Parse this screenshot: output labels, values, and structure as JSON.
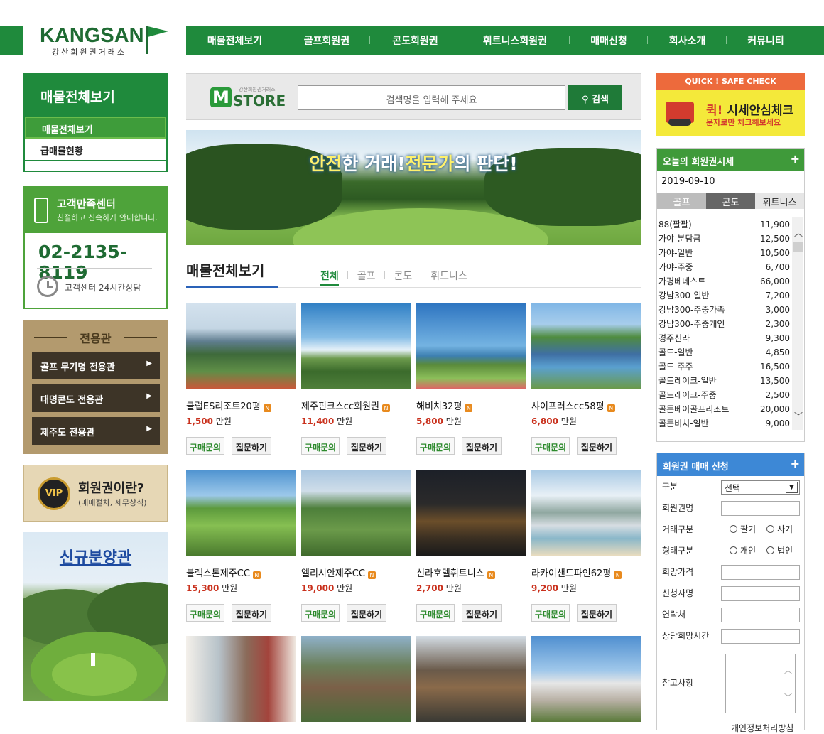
{
  "header": {
    "logo": {
      "brand": "KANGSAN",
      "sub": "강산회원권거래소"
    },
    "nav": [
      "매물전체보기",
      "골프회원권",
      "콘도회원권",
      "휘트니스회원권",
      "매매신청",
      "회사소개",
      "커뮤니티"
    ]
  },
  "sidebar": {
    "category_title": "매물전체보기",
    "items": [
      "매물전체보기",
      "급매물현황"
    ],
    "cs": {
      "title": "고객만족센터",
      "desc": "친절하고 신속하게 안내합니다.",
      "phone": "02-2135-8119",
      "hours": "고객센터 24시간상담"
    },
    "pavilion": {
      "title": "전용관",
      "buttons": [
        "골프 무기명 전용관",
        "대명콘도 전용관",
        "제주도 전용관"
      ]
    },
    "vip": {
      "badge": "VIP",
      "title": "회원권이란?",
      "desc": "(매매절차, 세무상식)"
    },
    "new_sale": "신규분양관"
  },
  "search": {
    "logo": "STORE",
    "logo_small": "강산회원권거래소",
    "placeholder": "검색명을 입력해 주세요",
    "button": "검색"
  },
  "banner": {
    "text_pre": "한 거래!",
    "text_hl1": "안전",
    "text_hl2": "전문가",
    "text_post": "의 판단!"
  },
  "listing": {
    "title": "매물전체보기",
    "tabs": [
      "전체",
      "골프",
      "콘도",
      "휘트니스"
    ],
    "unit": "만원",
    "btn_buy": "구매문의",
    "btn_ask": "질문하기",
    "products": [
      {
        "name": "클럽ES리조트20평",
        "price": "1,500"
      },
      {
        "name": "제주핀크스cc회원권",
        "price": "11,400"
      },
      {
        "name": "해비치32평",
        "price": "5,800"
      },
      {
        "name": "샤이프러스cc58평",
        "price": "6,800"
      },
      {
        "name": "블랙스톤제주CC",
        "price": "15,300"
      },
      {
        "name": "엘리시안제주CC",
        "price": "19,000"
      },
      {
        "name": "신라호텔휘트니스",
        "price": "2,700"
      },
      {
        "name": "라카이샌드파인62평",
        "price": "9,200"
      }
    ]
  },
  "quick": {
    "header": "QUICK ! SAFE CHECK",
    "title_hl": "퀵!",
    "title": "시세안심체크",
    "sub": "문자로만 체크해보세요"
  },
  "rates": {
    "title": "오늘의 회원권시세",
    "date": "2019-09-10",
    "tabs": [
      "골프",
      "콘도",
      "휘트니스"
    ],
    "rows": [
      {
        "name": "88(팔팔)",
        "price": "11,900"
      },
      {
        "name": "가야-분담금",
        "price": "12,500"
      },
      {
        "name": "가야-일반",
        "price": "10,500"
      },
      {
        "name": "가야-주중",
        "price": "6,700"
      },
      {
        "name": "가평베네스트",
        "price": "66,000"
      },
      {
        "name": "강남300-일반",
        "price": "7,200"
      },
      {
        "name": "강남300-주중가족",
        "price": "3,000"
      },
      {
        "name": "강남300-주중개인",
        "price": "2,300"
      },
      {
        "name": "경주신라",
        "price": "9,300"
      },
      {
        "name": "골드-일반",
        "price": "4,850"
      },
      {
        "name": "골드-주주",
        "price": "16,500"
      },
      {
        "name": "골드레이크-일반",
        "price": "13,500"
      },
      {
        "name": "골드레이크-주중",
        "price": "2,500"
      },
      {
        "name": "골든베이골프리조트",
        "price": "20,000"
      },
      {
        "name": "골든비치-일반",
        "price": "9,000"
      }
    ]
  },
  "apply": {
    "title": "회원권 매매 신청",
    "labels": [
      "구분",
      "회원권명",
      "거래구분",
      "형태구분",
      "희망가격",
      "신청자명",
      "연락처",
      "상담희망시간",
      "참고사항"
    ],
    "select": "선택",
    "trade": [
      "팔기",
      "사기"
    ],
    "type": [
      "개인",
      "법인"
    ],
    "privacy": "개인정보처리방침"
  },
  "colors": {
    "primary": "#1f8a3c",
    "accent": "#3e9c3a",
    "price": "#c9301c",
    "apply": "#3d88d6"
  }
}
